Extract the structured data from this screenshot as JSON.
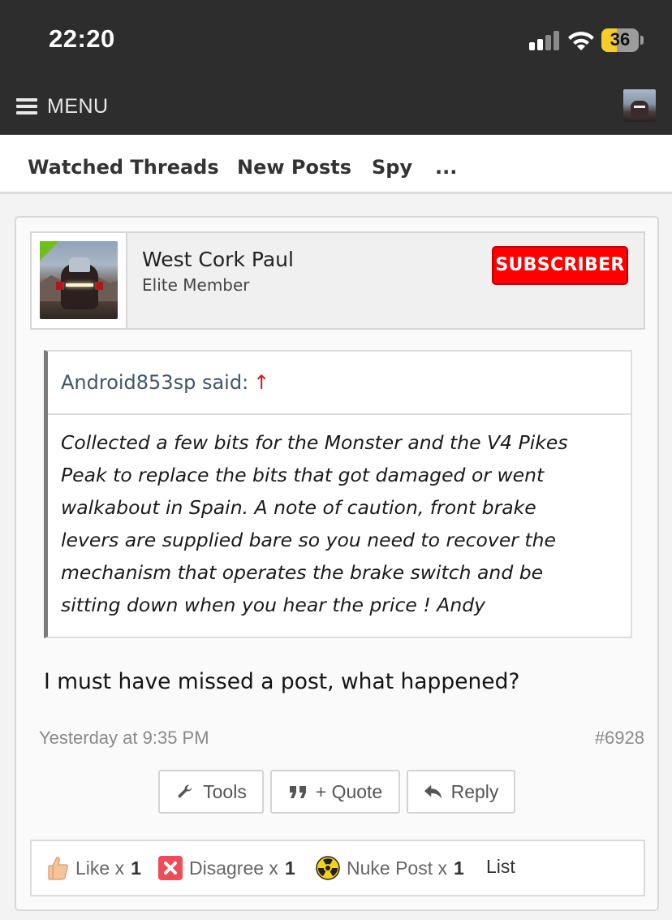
{
  "status_bar": {
    "time": "22:20",
    "battery": "36",
    "icons": [
      "cellular-signal-icon",
      "wifi-icon",
      "battery-icon"
    ]
  },
  "header": {
    "menu_label": "MENU",
    "menu_icon": "hamburger-icon"
  },
  "tabs": [
    {
      "label": "Watched Threads"
    },
    {
      "label": "New Posts"
    },
    {
      "label": "Spy"
    },
    {
      "label": "..."
    }
  ],
  "post": {
    "author": {
      "name": "West Cork Paul",
      "title": "Elite Member",
      "badge": "SUBSCRIBER"
    },
    "quote": {
      "author": "Android853sp said:",
      "arrow": "↑",
      "lines": [
        "Collected a few bits for the Monster and the V4 Pikes",
        "Peak to replace the bits that got damaged or went",
        "walkabout in Spain. A note of caution, front brake",
        "levers are supplied bare so you need to recover the",
        "mechanism that operates the brake switch and be",
        "sitting down when you hear the price ! Andy"
      ]
    },
    "message": "I must have missed a post, what happened?",
    "date": "Yesterday at 9:35 PM",
    "number": "#6928",
    "actions": {
      "tools": "Tools",
      "quote": "+ Quote",
      "reply": "Reply"
    },
    "reactions": {
      "like": {
        "label": "Like x",
        "count": "1"
      },
      "disagree": {
        "label": "Disagree x",
        "count": "1"
      },
      "nuke": {
        "label": "Nuke Post x",
        "count": "1"
      },
      "list": "List"
    }
  },
  "colors": {
    "header_bg": "#2d2d2d",
    "subscriber_badge": "#ff0000",
    "quote_author": "#3f566b",
    "online_indicator": "#6fbf1c"
  }
}
